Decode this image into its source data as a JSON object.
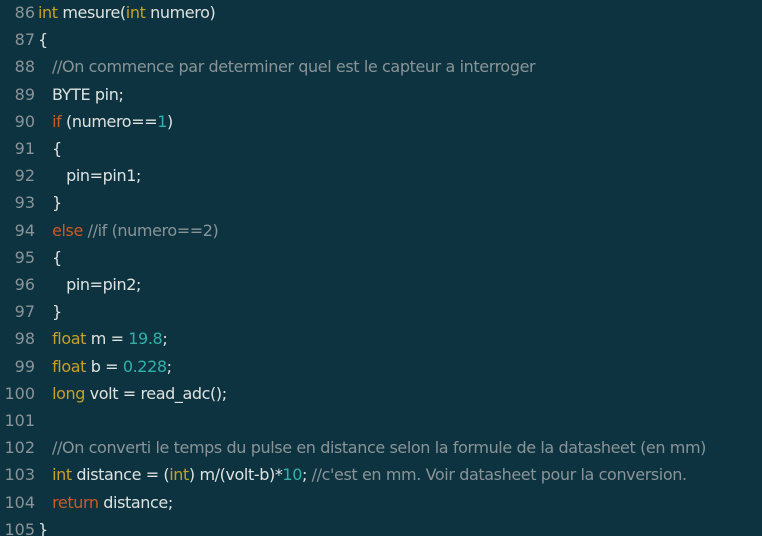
{
  "editor": {
    "colors": {
      "background": "#0d3341",
      "text": "#dfe3e0",
      "line_number": "#8a9497",
      "type_keyword": "#c8a025",
      "control_keyword": "#cc5a22",
      "number": "#2fb2a7",
      "comment": "#8a9497"
    },
    "lines": [
      {
        "number": "86",
        "tokens": [
          {
            "t": "int",
            "c": "kw"
          },
          {
            "t": " mesure(",
            "c": "plain"
          },
          {
            "t": "int",
            "c": "kw"
          },
          {
            "t": " numero)",
            "c": "plain"
          }
        ]
      },
      {
        "number": "87",
        "tokens": [
          {
            "t": "{",
            "c": "plain"
          }
        ]
      },
      {
        "number": "88",
        "tokens": [
          {
            "t": "   //On commence par determiner quel est le capteur a interroger",
            "c": "cmt"
          }
        ]
      },
      {
        "number": "89",
        "tokens": [
          {
            "t": "   BYTE pin;",
            "c": "plain"
          }
        ]
      },
      {
        "number": "90",
        "tokens": [
          {
            "t": "   ",
            "c": "plain"
          },
          {
            "t": "if",
            "c": "ctrl"
          },
          {
            "t": " (numero==",
            "c": "plain"
          },
          {
            "t": "1",
            "c": "num"
          },
          {
            "t": ")",
            "c": "plain"
          }
        ]
      },
      {
        "number": "91",
        "tokens": [
          {
            "t": "   {",
            "c": "plain"
          }
        ]
      },
      {
        "number": "92",
        "tokens": [
          {
            "t": "      pin=pin1;",
            "c": "plain"
          }
        ]
      },
      {
        "number": "93",
        "tokens": [
          {
            "t": "   }",
            "c": "plain"
          }
        ]
      },
      {
        "number": "94",
        "tokens": [
          {
            "t": "   ",
            "c": "plain"
          },
          {
            "t": "else",
            "c": "ctrl"
          },
          {
            "t": " ",
            "c": "plain"
          },
          {
            "t": "//if (numero==2)",
            "c": "cmt"
          }
        ]
      },
      {
        "number": "95",
        "tokens": [
          {
            "t": "   {",
            "c": "plain"
          }
        ]
      },
      {
        "number": "96",
        "tokens": [
          {
            "t": "      pin=pin2;",
            "c": "plain"
          }
        ]
      },
      {
        "number": "97",
        "tokens": [
          {
            "t": "   }",
            "c": "plain"
          }
        ]
      },
      {
        "number": "98",
        "tokens": [
          {
            "t": "   ",
            "c": "plain"
          },
          {
            "t": "float",
            "c": "kw"
          },
          {
            "t": " m = ",
            "c": "plain"
          },
          {
            "t": "19.8",
            "c": "num"
          },
          {
            "t": ";",
            "c": "plain"
          }
        ]
      },
      {
        "number": "99",
        "tokens": [
          {
            "t": "   ",
            "c": "plain"
          },
          {
            "t": "float",
            "c": "kw"
          },
          {
            "t": " b = ",
            "c": "plain"
          },
          {
            "t": "0.228",
            "c": "num"
          },
          {
            "t": ";",
            "c": "plain"
          }
        ]
      },
      {
        "number": "100",
        "tokens": [
          {
            "t": "   ",
            "c": "plain"
          },
          {
            "t": "long",
            "c": "kw"
          },
          {
            "t": " volt = read_adc();",
            "c": "plain"
          }
        ]
      },
      {
        "number": "101",
        "tokens": []
      },
      {
        "number": "102",
        "tokens": [
          {
            "t": "   //On converti le temps du pulse en distance selon la formule de la datasheet (en mm)",
            "c": "cmt"
          }
        ]
      },
      {
        "number": "103",
        "tokens": [
          {
            "t": "   ",
            "c": "plain"
          },
          {
            "t": "int",
            "c": "kw"
          },
          {
            "t": " distance = (",
            "c": "plain"
          },
          {
            "t": "int",
            "c": "kw"
          },
          {
            "t": ") m/(volt-b)*",
            "c": "plain"
          },
          {
            "t": "10",
            "c": "num"
          },
          {
            "t": "; ",
            "c": "plain"
          },
          {
            "t": "//c'est en mm. Voir datasheet pour la conversion.",
            "c": "cmt"
          }
        ]
      },
      {
        "number": "104",
        "tokens": [
          {
            "t": "   ",
            "c": "plain"
          },
          {
            "t": "return",
            "c": "ctrl"
          },
          {
            "t": " distance;",
            "c": "plain"
          }
        ]
      },
      {
        "number": "105",
        "tokens": [
          {
            "t": "}",
            "c": "plain"
          }
        ]
      }
    ]
  }
}
